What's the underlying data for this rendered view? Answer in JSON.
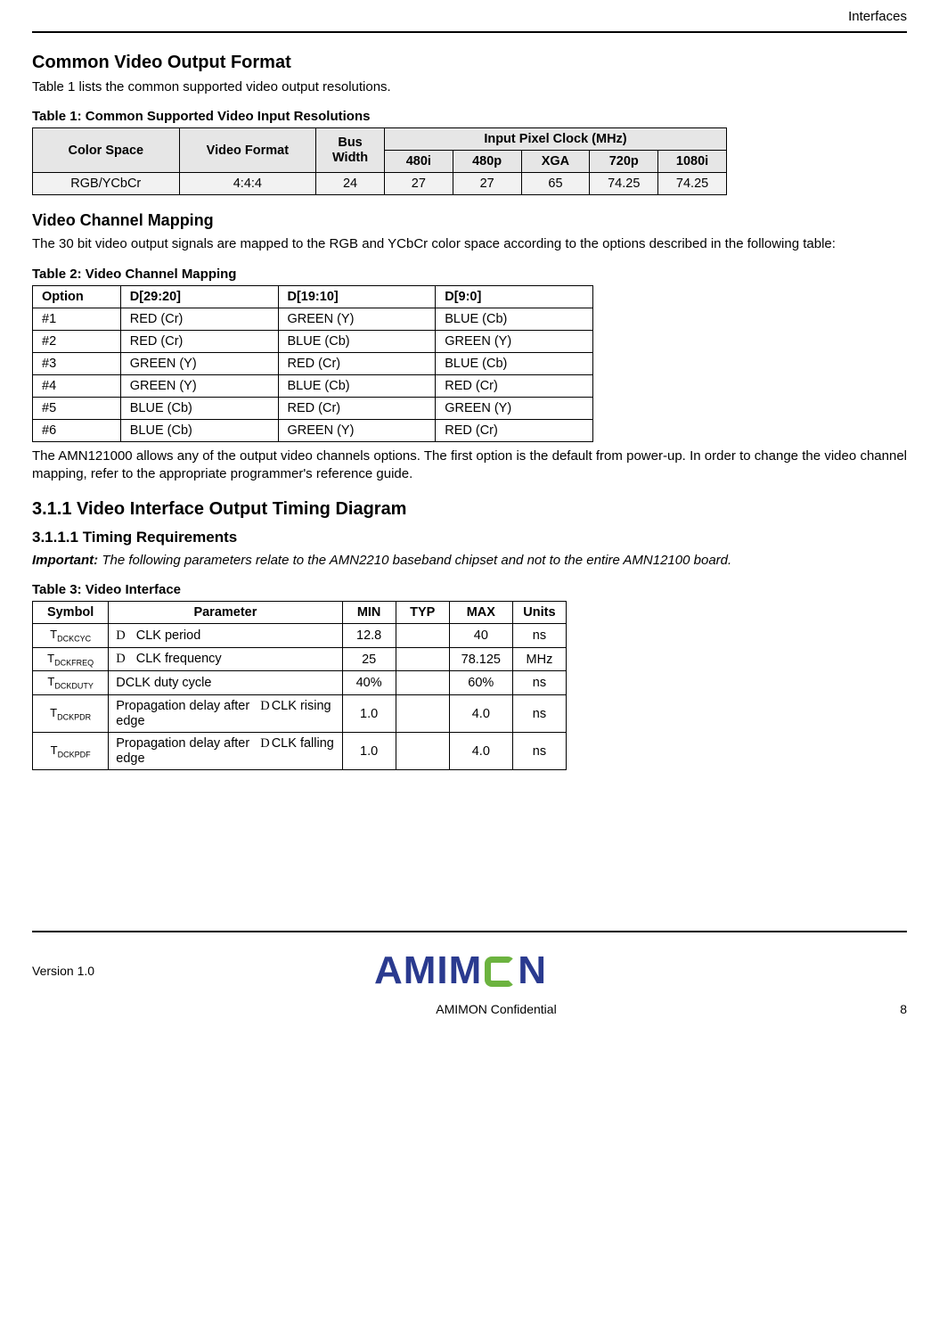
{
  "header": {
    "section_label": "Interfaces"
  },
  "s1": {
    "title": "Common Video Output Format",
    "intro": "Table 1 lists the common supported video output resolutions.",
    "caption": "Table 1: Common Supported Video Input Resolutions",
    "cols": {
      "color_space": "Color Space",
      "video_format": "Video Format",
      "bus_width": "Bus Width",
      "clock_group": "Input Pixel Clock (MHz)",
      "c480i": "480i",
      "c480p": "480p",
      "cxga": "XGA",
      "c720p": "720p",
      "c1080i": "1080i"
    },
    "row": {
      "color_space": "RGB/YCbCr",
      "video_format": "4:4:4",
      "bus_width": "24",
      "v480i": "27",
      "v480p": "27",
      "vxga": "65",
      "v720p": "74.25",
      "v1080i": "74.25"
    }
  },
  "s2": {
    "title": "Video Channel Mapping",
    "intro": "The 30 bit video output signals are mapped to the RGB and YCbCr color space according to the options described in the following table:",
    "caption": "Table 2: Video Channel Mapping",
    "headers": {
      "option": "Option",
      "d29": "D[29:20]",
      "d19": "D[19:10]",
      "d9": "D[9:0]"
    },
    "rows": [
      {
        "opt": "#1",
        "a": "RED (Cr)",
        "b": "GREEN (Y)",
        "c": "BLUE (Cb)"
      },
      {
        "opt": "#2",
        "a": "RED (Cr)",
        "b": "BLUE (Cb)",
        "c": "GREEN (Y)"
      },
      {
        "opt": "#3",
        "a": "GREEN (Y)",
        "b": "RED (Cr)",
        "c": "BLUE (Cb)"
      },
      {
        "opt": "#4",
        "a": "GREEN (Y)",
        "b": "BLUE (Cb)",
        "c": "RED (Cr)"
      },
      {
        "opt": "#5",
        "a": "BLUE (Cb)",
        "b": "RED (Cr)",
        "c": "GREEN (Y)"
      },
      {
        "opt": "#6",
        "a": "BLUE (Cb)",
        "b": "GREEN (Y)",
        "c": "RED (Cr)"
      }
    ],
    "outro": "The AMN121000 allows any of the output video channels options. The first option is the default from power-up. In order to change the video channel mapping, refer to the appropriate programmer's reference guide."
  },
  "s3": {
    "h3": "3.1.1   Video Interface Output Timing Diagram",
    "h4": "3.1.1.1   Timing Requirements",
    "important_label": "Important:",
    "important_text": " The following parameters relate to the AMN2210 baseband chipset and not to the entire AMN12100 board.",
    "caption": "Table 3: Video Interface",
    "headers": {
      "symbol": "Symbol",
      "param": "Parameter",
      "min": "MIN",
      "typ": "TYP",
      "max": "MAX",
      "units": "Units"
    },
    "rows": [
      {
        "sym_main": "T",
        "sym_sub": "DCKCYC",
        "param_pre": "D",
        "param": "CLK period",
        "param_suf": "",
        "min": "12.8",
        "typ": "",
        "max": "40",
        "units": "ns"
      },
      {
        "sym_main": "T",
        "sym_sub": "DCKFREQ",
        "param_pre": "D",
        "param": "CLK frequency",
        "param_suf": "",
        "min": "25",
        "typ": "",
        "max": "78.125",
        "units": "MHz"
      },
      {
        "sym_main": "T",
        "sym_sub": "DCKDUTY",
        "param_pre": "",
        "param": "DCLK duty cycle",
        "param_suf": "",
        "min": "40%",
        "typ": "",
        "max": "60%",
        "units": "ns"
      },
      {
        "sym_main": "T",
        "sym_sub": "DCKPDR",
        "param_pre": "",
        "param": "Propagation delay after ",
        "param_suf": "D",
        "param_after": "CLK rising edge",
        "min": "1.0",
        "typ": "",
        "max": "4.0",
        "units": "ns"
      },
      {
        "sym_main": "T",
        "sym_sub": "DCKPDF",
        "param_pre": "",
        "param": "Propagation delay after ",
        "param_suf": "D",
        "param_after": "CLK falling edge",
        "min": "1.0",
        "typ": "",
        "max": "4.0",
        "units": "ns"
      }
    ]
  },
  "footer": {
    "version": "Version 1.0",
    "logo_a": "AMIM",
    "logo_b": "N",
    "confidential": "AMIMON Confidential",
    "page": "8"
  }
}
